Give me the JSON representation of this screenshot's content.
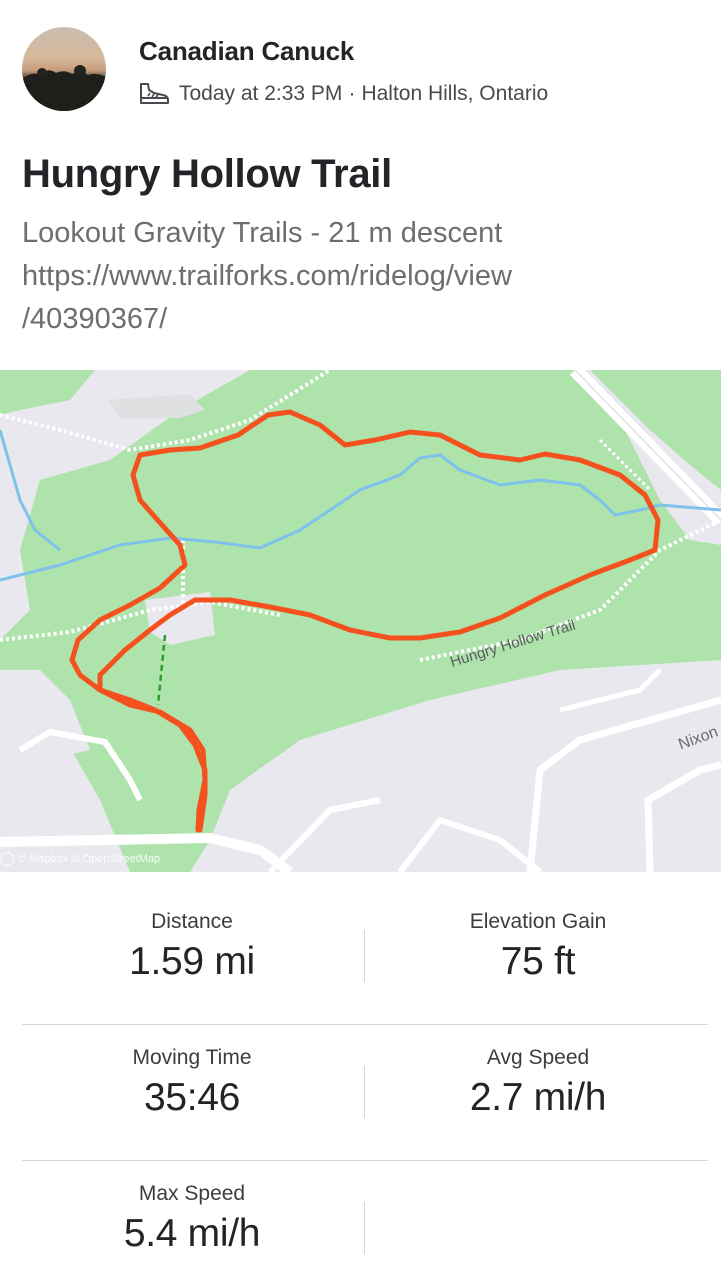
{
  "athlete": {
    "name": "Canadian Canuck",
    "time": "Today at 2:33 PM",
    "separator": "·",
    "location": "Halton Hills, Ontario",
    "sport_icon": "hike-shoe-icon"
  },
  "activity": {
    "title": "Hungry Hollow Trail",
    "description_lines": [
      "Lookout Gravity Trails - 21 m descent",
      "https://www.trailforks.com/ridelog/view",
      "/40390367/"
    ]
  },
  "map": {
    "attribution": "© Mapbox © OpenStreetMap",
    "trail_label": "Hungry Hollow Trail",
    "street_label": "Nixon",
    "colors": {
      "route": "#f4511e",
      "park": "#aee3ab",
      "water": "#7ec2ec",
      "background": "#e9e8ee",
      "road": "#ffffff"
    }
  },
  "stats": [
    {
      "label": "Distance",
      "value": "1.59 mi"
    },
    {
      "label": "Elevation Gain",
      "value": "75 ft"
    },
    {
      "label": "Moving Time",
      "value": "35:46"
    },
    {
      "label": "Avg Speed",
      "value": "2.7 mi/h"
    },
    {
      "label": "Max Speed",
      "value": "5.4 mi/h"
    }
  ]
}
